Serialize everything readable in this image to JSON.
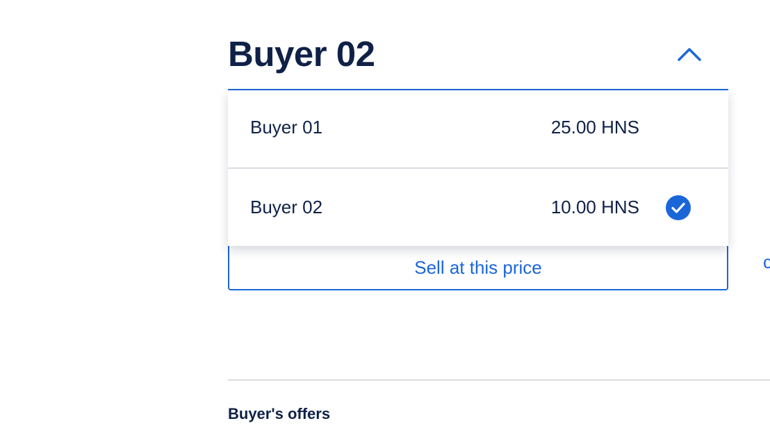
{
  "selector": {
    "selected_label": "Buyer 02",
    "toggle_icon": "chevron-up-icon"
  },
  "options": [
    {
      "name": "Buyer 01",
      "price": "25.00 HNS",
      "selected": false
    },
    {
      "name": "Buyer 02",
      "price": "10.00 HNS",
      "selected": true
    }
  ],
  "actions": {
    "sell_label": "Sell at this price",
    "cutoff_label": "c"
  },
  "offers_section": {
    "heading": "Buyer's offers"
  },
  "colors": {
    "accent": "#1a66d9",
    "text_dark": "#0f2147",
    "divider": "#d9dce1"
  }
}
